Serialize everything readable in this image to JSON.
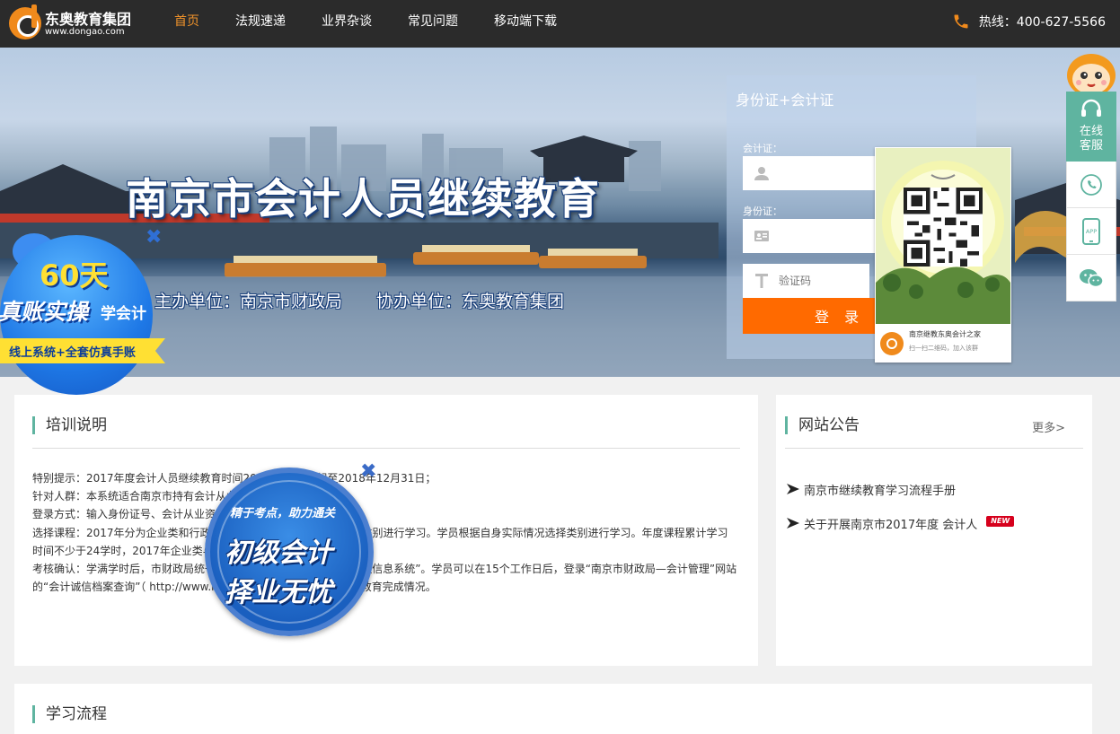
{
  "brand": {
    "name_cn": "东奥教育集团",
    "domain": "www.dongao.com",
    "accent": "#f08a1c"
  },
  "nav": {
    "items": [
      {
        "label": "首页",
        "active": true
      },
      {
        "label": "法规速递",
        "active": false
      },
      {
        "label": "业界杂谈",
        "active": false
      },
      {
        "label": "常见问题",
        "active": false
      },
      {
        "label": "移动端下载",
        "active": false
      }
    ],
    "active_color": "#f0932b"
  },
  "hotline": {
    "label": "热线：400-627-5566",
    "icon": "phone-icon"
  },
  "banner": {
    "title": "南京市会计人员继续教育",
    "subtitle": "主办单位：南京市财政局　　协办单位：东奥教育集团"
  },
  "login": {
    "title": "身份证+会计证",
    "accounting_label": "会计证：",
    "id_label": "身份证：",
    "captcha_placeholder": "验证码",
    "submit_label": "登 录",
    "submit_color": "#ff6a00"
  },
  "qr_popup": {
    "name": "南京继教东奥会计之家",
    "hint": "扫一扫二维码，加入该群"
  },
  "promo_60": {
    "line1": "60天",
    "line2": "真账实操",
    "line3": "学会计",
    "ribbon": "线上系统+全套仿真手账"
  },
  "promo_chuji": {
    "slogan": "精于考点，助力通关",
    "line1": "初级会计",
    "line2": "择业无忧"
  },
  "side_service": {
    "line1": "在线",
    "line2": "客服",
    "items": [
      "phone-icon",
      "app-icon",
      "wechat-icon"
    ],
    "app_label": "APP",
    "color": "#5fb4a0"
  },
  "training": {
    "title": "培训说明",
    "lines": [
      "特别提示：2017年度会计人员继续教育时间2018年1月1日起至2018年12月31日；",
      "针对人群：本系统适合南京市持有会计从业资格证书的人员；",
      "登录方式：输入身份证号、会计从业资格证号及验证码登录；",
      "选择课程：2017年分为企业类和行政事业类课程，请您根据自身所属类别进行学习。学员根据自身实际情况选择类别进行学习。年度课程累计学习",
      "时间不少于24学时，2017年企业类与行政事业类课程互认；",
      "考核确认：学满学时后，市财政局统一将学时上报至“会计从业资格管理信息系统”。学员可以在15个工作日后，登录“南京市财政局—会计管理”网站",
      "的“会计诚信档案查询”（ http://www.njcz.gov.cn ）栏目，查询继续教育完成情况。"
    ]
  },
  "notice": {
    "title": "网站公告",
    "more": "更多>",
    "items": [
      {
        "text": "南京市继续教育学习流程手册",
        "is_new": false
      },
      {
        "text": "关于开展南京市2017年度 会计人",
        "is_new": true
      }
    ],
    "new_badge": "NEW"
  },
  "flow": {
    "title": "学习流程"
  }
}
